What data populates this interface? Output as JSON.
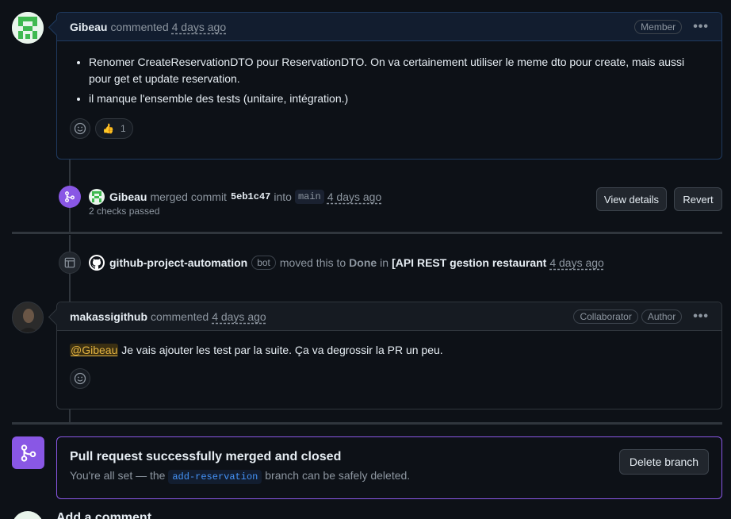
{
  "comment1": {
    "author": "Gibeau",
    "action": "commented",
    "time": "4 days ago",
    "badge": "Member",
    "menu": "•••",
    "items": [
      "Renomer CreateReservationDTO pour ReservationDTO. On va certainement utiliser le meme dto pour create, mais aussi pour get et update reservation.",
      "il manque l'ensemble des tests (unitaire, intégration.)"
    ],
    "reaction_emoji": "👍",
    "reaction_count": "1"
  },
  "merge_event": {
    "author": "Gibeau",
    "action": "merged commit",
    "sha": "5eb1c47",
    "into": "into",
    "branch": "main",
    "time": "4 days ago",
    "checks": "2 checks passed",
    "view_details": "View details",
    "revert": "Revert"
  },
  "project_event": {
    "author": "github-project-automation",
    "bot_badge": "bot",
    "action_pre": "moved this to",
    "column": "Done",
    "in": "in",
    "project": "[API REST gestion restaurant",
    "time": "4 days ago"
  },
  "comment2": {
    "author": "makassigithub",
    "action": "commented",
    "time": "4 days ago",
    "badge1": "Collaborator",
    "badge2": "Author",
    "menu": "•••",
    "mention": "@Gibeau",
    "body": "Je vais ajouter les test par la suite. Ça va degrossir la PR un peu."
  },
  "merged_status": {
    "title": "Pull request successfully merged and closed",
    "desc_pre": "You're all set — the",
    "branch": "add-reservation",
    "desc_post": "branch can be safely deleted.",
    "delete_button": "Delete branch"
  },
  "add_comment": {
    "title": "Add a comment"
  },
  "colors": {
    "merged_purple": "#8957e5",
    "mention_yellow": "#e3b341",
    "link_blue": "#4493f8"
  }
}
